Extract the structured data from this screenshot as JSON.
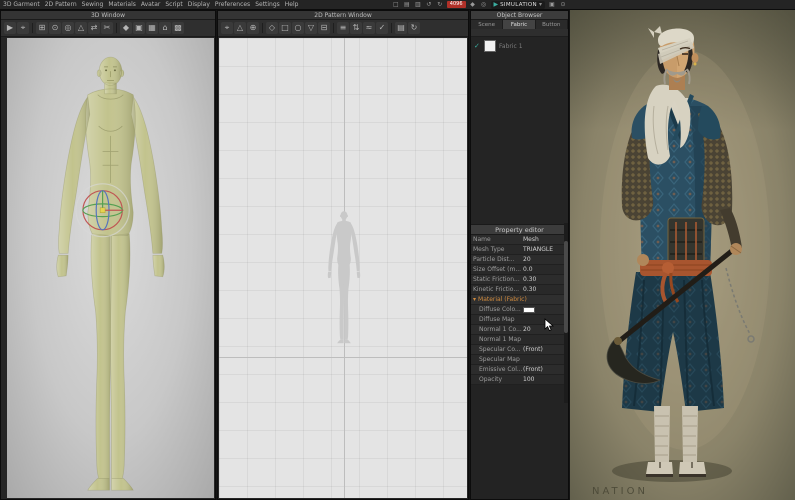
{
  "colors": {
    "accent_teal": "#3aaea0",
    "badge_red": "#b03028",
    "section_orange": "#cf8a3e",
    "diffuse_swatch": "#ffffff",
    "avatar_skin": "#c2c38d",
    "robe_blue": "#2b4f63",
    "sash_orange": "#a8552f"
  },
  "menubar": {
    "items": [
      "3D Garment",
      "2D Pattern",
      "Sewing",
      "Materials",
      "Avatar",
      "Script",
      "Display",
      "Preferences",
      "Settings",
      "Help"
    ],
    "file_icons": [
      {
        "name": "new-file-icon",
        "glyph": "□"
      },
      {
        "name": "open-file-icon",
        "glyph": "▤"
      },
      {
        "name": "save-file-icon",
        "glyph": "▥"
      },
      {
        "name": "undo-icon",
        "glyph": "↺"
      },
      {
        "name": "redo-icon",
        "glyph": "↻"
      }
    ],
    "badge": "4096",
    "mid_icons": [
      {
        "name": "avatar-display-icon",
        "glyph": "◆"
      },
      {
        "name": "render-icon",
        "glyph": "◎"
      }
    ],
    "simulation": {
      "label": "SIMULATION",
      "play_glyph": "▶",
      "dropdown_glyph": "▾"
    },
    "end_icons": [
      {
        "name": "snapshot-icon",
        "glyph": "▣"
      },
      {
        "name": "settings-icon",
        "glyph": "⊙"
      }
    ]
  },
  "window_3d": {
    "title": "3D Window",
    "icons": [
      {
        "name": "simulate-icon",
        "glyph": "▶"
      },
      {
        "name": "select-move-icon",
        "glyph": "⌖"
      },
      {
        "name": "box-select-icon",
        "glyph": "⊞"
      },
      {
        "name": "pin-icon",
        "glyph": "⊙"
      },
      {
        "name": "tack-icon",
        "glyph": "◎"
      },
      {
        "name": "pinch-icon",
        "glyph": "△"
      },
      {
        "name": "measure-icon",
        "glyph": "⇄"
      },
      {
        "name": "scissors-icon",
        "glyph": "✂"
      },
      {
        "name": "show-avatar-icon",
        "glyph": "◆"
      },
      {
        "name": "pattern-3d-icon",
        "glyph": "▣"
      },
      {
        "name": "texture-icon",
        "glyph": "▦"
      },
      {
        "name": "reset-view-icon",
        "glyph": "⌂"
      },
      {
        "name": "grid-icon",
        "glyph": "▩"
      }
    ]
  },
  "window_2d": {
    "title": "2D Pattern Window",
    "icons": [
      {
        "name": "transform-icon",
        "glyph": "⌖"
      },
      {
        "name": "edit-pattern-icon",
        "glyph": "△"
      },
      {
        "name": "add-point-icon",
        "glyph": "⊕"
      },
      {
        "name": "polygon-icon",
        "glyph": "◇"
      },
      {
        "name": "rectangle-icon",
        "glyph": "□"
      },
      {
        "name": "circle-icon",
        "glyph": "○"
      },
      {
        "name": "dart-icon",
        "glyph": "▽"
      },
      {
        "name": "notch-icon",
        "glyph": "⊟"
      },
      {
        "name": "seam-icon",
        "glyph": "≡"
      },
      {
        "name": "segment-sew-icon",
        "glyph": "⇅"
      },
      {
        "name": "free-sew-icon",
        "glyph": "≈"
      },
      {
        "name": "show-sewing-icon",
        "glyph": "✓"
      },
      {
        "name": "texture-edit-icon",
        "glyph": "▤"
      },
      {
        "name": "sync-icon",
        "glyph": "↻"
      }
    ]
  },
  "object_browser": {
    "title": "Object Browser",
    "tabs": [
      "Scene",
      "Fabric",
      "Button"
    ],
    "item": {
      "check_glyph": "✓",
      "label": "Fabric 1"
    }
  },
  "property_editor": {
    "title": "Property editor",
    "rows": [
      {
        "label": "Name",
        "value": "Mesh"
      },
      {
        "label": "Mesh Type",
        "value": "TRIANGLE"
      },
      {
        "label": "Particle Dist...",
        "value": "20"
      },
      {
        "label": "Size Offset (m...",
        "value": "0.0"
      },
      {
        "label": "Static Friction...",
        "value": "0.30"
      },
      {
        "label": "Kinetic Frictio...",
        "value": "0.30"
      }
    ],
    "material_section": {
      "label": "Material (Fabric)",
      "arrow_glyph": "▾"
    },
    "material_rows": [
      {
        "label": "Diffuse Colo...",
        "value": ""
      },
      {
        "label": "Diffuse Map",
        "value": ""
      },
      {
        "label": "Normal 1 Co...",
        "value": "20"
      },
      {
        "label": "Normal 1 Map",
        "value": ""
      },
      {
        "label": "Specular Co...",
        "value": "(Front)"
      },
      {
        "label": "Specular Map",
        "value": ""
      },
      {
        "label": "Emissive Col...",
        "value": "(Front)"
      },
      {
        "label": "Opacity",
        "value": "100"
      }
    ]
  },
  "reference": {
    "caption": "NATION"
  }
}
